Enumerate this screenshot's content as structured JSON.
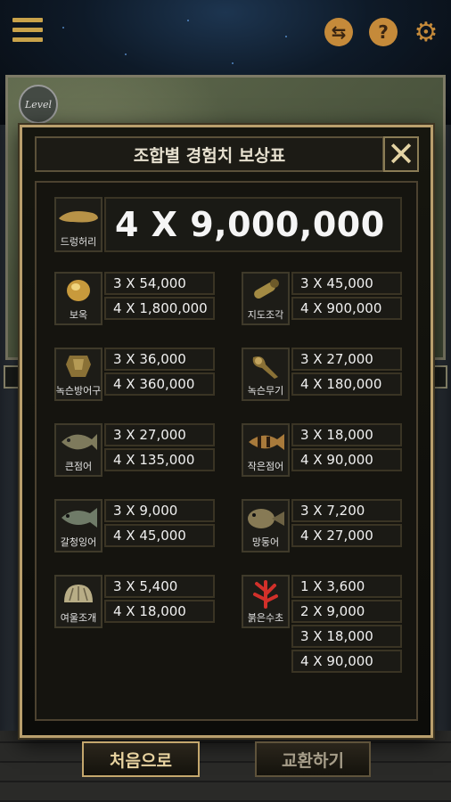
{
  "topbar": {
    "menu_icon": "hamburger-menu-icon",
    "swap_icon": "swap-arrows-icon",
    "help_label": "?",
    "settings_icon": "gear-icon"
  },
  "map": {
    "level_label": "Level"
  },
  "modal": {
    "title": "조합별 경험치 보상표",
    "close_label": "✕",
    "top_reward": {
      "name": "드렁허리",
      "value": "4 X 9,000,000"
    },
    "items": [
      {
        "name": "보옥",
        "values": [
          "3 X 54,000",
          "4 X 1,800,000"
        ]
      },
      {
        "name": "지도조각",
        "values": [
          "3 X 45,000",
          "4 X 900,000"
        ]
      },
      {
        "name": "녹슨방어구",
        "values": [
          "3 X 36,000",
          "4 X 360,000"
        ]
      },
      {
        "name": "녹슨무기",
        "values": [
          "3 X 27,000",
          "4 X 180,000"
        ]
      },
      {
        "name": "큰점어",
        "values": [
          "3 X 27,000",
          "4 X 135,000"
        ]
      },
      {
        "name": "작은점어",
        "values": [
          "3 X 18,000",
          "4 X 90,000"
        ]
      },
      {
        "name": "갈청잉어",
        "values": [
          "3 X 9,000",
          "4 X 45,000"
        ]
      },
      {
        "name": "망둥어",
        "values": [
          "3 X 7,200",
          "4 X 27,000"
        ]
      },
      {
        "name": "여울조개",
        "values": [
          "3 X 5,400",
          "4 X 18,000"
        ]
      },
      {
        "name": "붉은수초",
        "values": [
          "1 X 3,600",
          "2 X 9,000",
          "3 X 18,000",
          "4 X 90,000"
        ]
      }
    ]
  },
  "buttons": {
    "first_label": "처음으로",
    "exchange_label": "교환하기"
  }
}
